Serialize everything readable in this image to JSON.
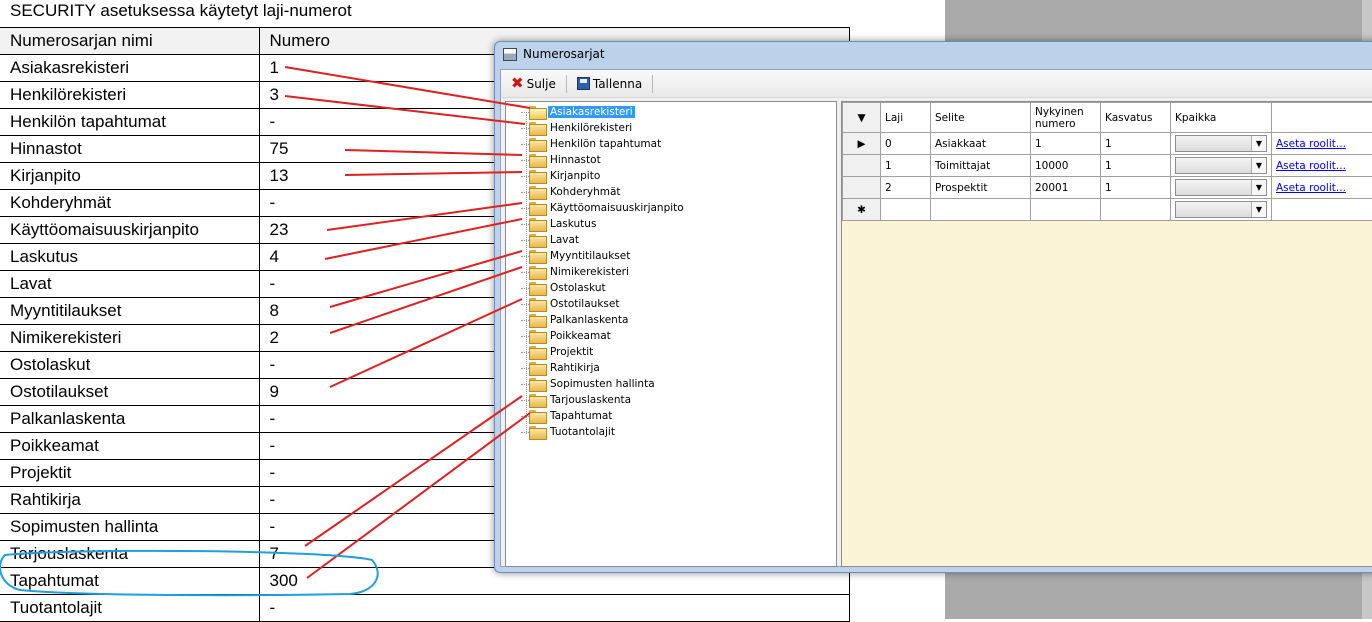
{
  "document": {
    "title": "SECURITY asetuksessa käytetyt laji-numerot",
    "headers": [
      "Numerosarjan nimi",
      "Numero"
    ],
    "rows": [
      {
        "name": "Asiakasrekisteri",
        "number": "1"
      },
      {
        "name": "Henkilörekisteri",
        "number": "3"
      },
      {
        "name": "Henkilön tapahtumat",
        "number": "-"
      },
      {
        "name": "Hinnastot",
        "number": "75"
      },
      {
        "name": "Kirjanpito",
        "number": "13"
      },
      {
        "name": "Kohderyhmät",
        "number": "-"
      },
      {
        "name": "Käyttöomaisuuskirjanpito",
        "number": "23"
      },
      {
        "name": "Laskutus",
        "number": "4"
      },
      {
        "name": "Lavat",
        "number": "-"
      },
      {
        "name": "Myyntitilaukset",
        "number": "8"
      },
      {
        "name": "Nimikerekisteri",
        "number": "2"
      },
      {
        "name": "Ostolaskut",
        "number": "-"
      },
      {
        "name": "Ostotilaukset",
        "number": "9"
      },
      {
        "name": "Palkanlaskenta",
        "number": "-"
      },
      {
        "name": "Poikkeamat",
        "number": "-"
      },
      {
        "name": "Projektit",
        "number": "-"
      },
      {
        "name": "Rahtikirja",
        "number": "-"
      },
      {
        "name": "Sopimusten hallinta",
        "number": "-"
      },
      {
        "name": "Tarjouslaskenta",
        "number": "7"
      },
      {
        "name": "Tapahtumat",
        "number": "300"
      },
      {
        "name": "Tuotantolajit",
        "number": "-"
      }
    ]
  },
  "window": {
    "title": "Numerosarjat",
    "toolbar": {
      "close_label": "Sulje",
      "save_label": "Tallenna"
    },
    "tree": {
      "selected_index": 0,
      "items": [
        "Asiakasrekisteri",
        "Henkilörekisteri",
        "Henkilön tapahtumat",
        "Hinnastot",
        "Kirjanpito",
        "Kohderyhmät",
        "Käyttöomaisuuskirjanpito",
        "Laskutus",
        "Lavat",
        "Myyntitilaukset",
        "Nimikerekisteri",
        "Ostolaskut",
        "Ostotilaukset",
        "Palkanlaskenta",
        "Poikkeamat",
        "Projektit",
        "Rahtikirja",
        "Sopimusten hallinta",
        "Tarjouslaskenta",
        "Tapahtumat",
        "Tuotantolajit"
      ]
    },
    "grid": {
      "headers": {
        "laji": "Laji",
        "selite": "Selite",
        "nykyinen_line1": "Nykyinen",
        "nykyinen_line2": "numero",
        "kasvatus": "Kasvatus",
        "kpaikka": "Kpaikka"
      },
      "rows": [
        {
          "laji": "0",
          "selite": "Asiakkaat",
          "nykyinen": "1",
          "kasvatus": "1",
          "link": "Aseta roolit..."
        },
        {
          "laji": "1",
          "selite": "Toimittajat",
          "nykyinen": "10000",
          "kasvatus": "1",
          "link": "Aseta roolit..."
        },
        {
          "laji": "2",
          "selite": "Prospektit",
          "nykyinen": "20001",
          "kasvatus": "1",
          "link": "Aseta roolit..."
        }
      ],
      "row_header_current": "▶",
      "row_header_new": "✱",
      "corner_glyph": "▼"
    }
  },
  "colors": {
    "annotation_line": "#e02020",
    "highlight_ellipse": "#1ea0e0",
    "tree_selection": "#3399ff",
    "grid_background": "#fbf3d5"
  }
}
